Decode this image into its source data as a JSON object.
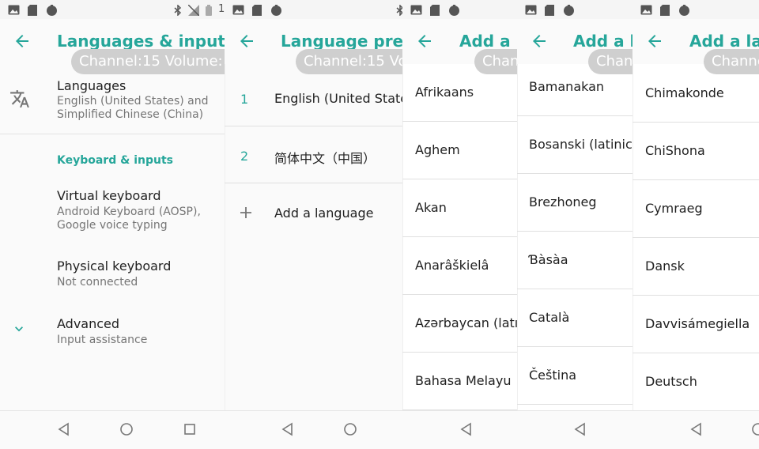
{
  "colors": {
    "accent": "#26a69a",
    "text": "#212121",
    "secondary": "#757575",
    "overlay": "#cfcfcf"
  },
  "status_bar": {
    "right_glyph": "1"
  },
  "overlay": {
    "text": "Channel:15  Volume:"
  },
  "panel1": {
    "title": "Languages & input",
    "languages": {
      "title": "Languages",
      "subtitle": "English (United States) and Simplified Chinese (China)"
    },
    "section_header": "Keyboard & inputs",
    "virtual_keyboard": {
      "title": "Virtual keyboard",
      "subtitle": "Android Keyboard (AOSP), Google voice typing"
    },
    "physical_keyboard": {
      "title": "Physical keyboard",
      "subtitle": "Not connected"
    },
    "advanced": {
      "title": "Advanced",
      "subtitle": "Input assistance"
    }
  },
  "panel2": {
    "title": "Language preferences",
    "items": [
      {
        "num": "1",
        "label": "English (United States)"
      },
      {
        "num": "2",
        "label": "简体中文（中国）"
      }
    ],
    "add_label": "Add a language"
  },
  "add_title": "Add a language",
  "panel3": {
    "items": [
      "Afrikaans",
      "Aghem",
      "Akan",
      "Anarâškielâ",
      "Azərbaycan (latın)",
      "Bahasa Melayu"
    ]
  },
  "panel4": {
    "items": [
      "Bamanakan",
      "Bosanski (latinica)",
      "Brezhoneg",
      "Ɓàsàa",
      "Català",
      "Čeština"
    ]
  },
  "panel5": {
    "items": [
      "Chimakonde",
      "ChiShona",
      "Cymraeg",
      "Dansk",
      "Davvisámegiella",
      "Deutsch"
    ]
  },
  "icons": {
    "back": "arrow-back-icon",
    "translate": "translate-icon",
    "chevron": "chevron-down-icon",
    "add": "plus-icon",
    "nav_back": "nav-back-icon",
    "nav_home": "nav-home-icon",
    "nav_recents": "nav-recents-icon"
  }
}
